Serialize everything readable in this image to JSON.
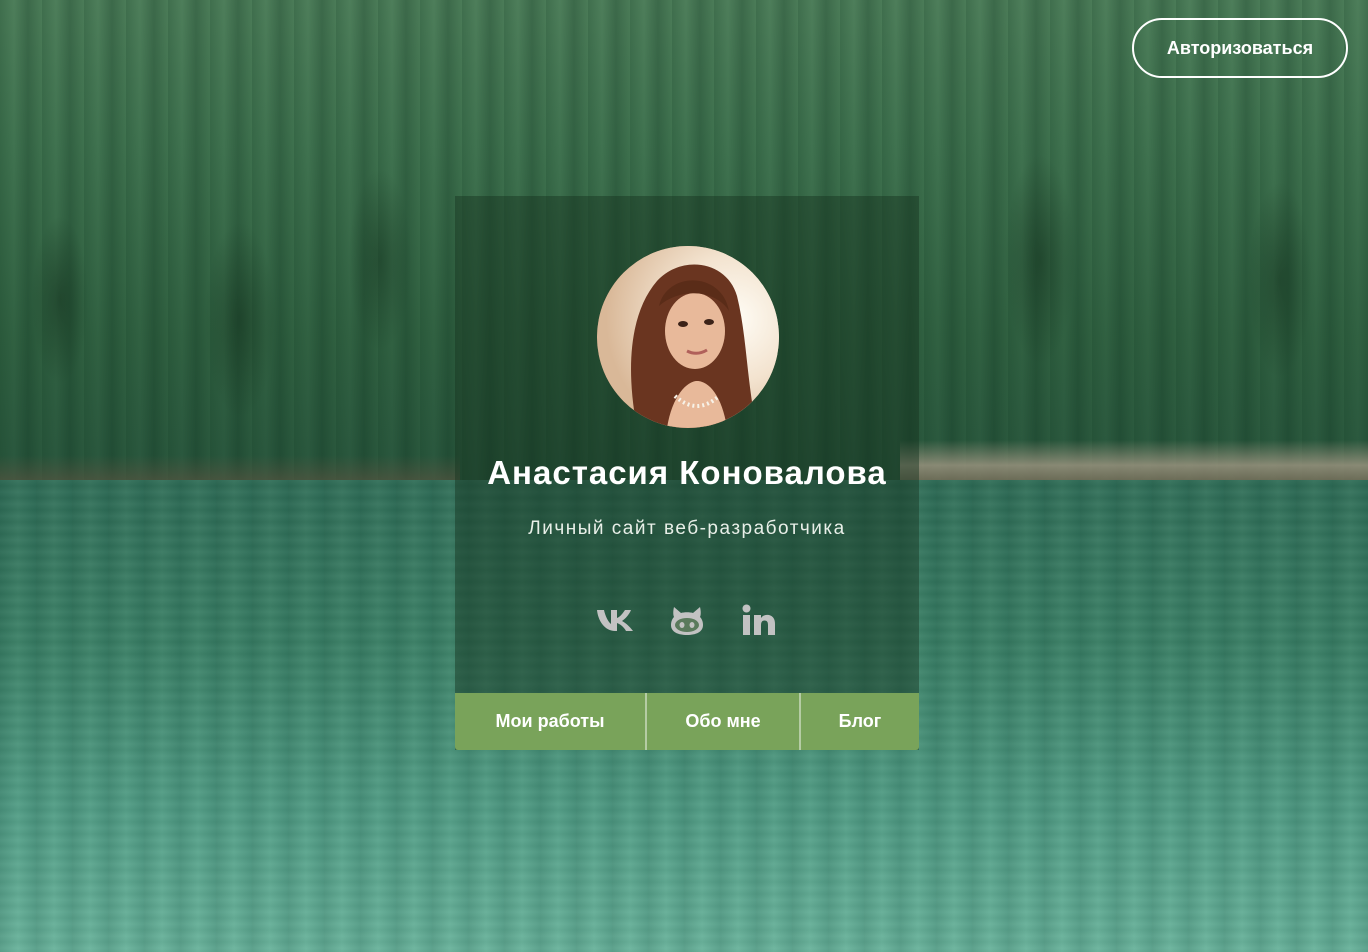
{
  "header": {
    "login_label": "Авторизоваться"
  },
  "profile": {
    "name": "Анастасия Коновалова",
    "subtitle": "Личный сайт веб-разработчика",
    "avatar_icon": "profile-photo"
  },
  "socials": [
    {
      "name": "vk",
      "icon": "vk-icon"
    },
    {
      "name": "github",
      "icon": "github-icon"
    },
    {
      "name": "linkedin",
      "icon": "linkedin-icon"
    }
  ],
  "nav": {
    "items": [
      {
        "label": "Мои работы"
      },
      {
        "label": "Обо мне"
      },
      {
        "label": "Блог"
      }
    ]
  },
  "colors": {
    "accent": "#79a35a",
    "icon_gray": "#c2c2c2",
    "text": "#ffffff"
  }
}
